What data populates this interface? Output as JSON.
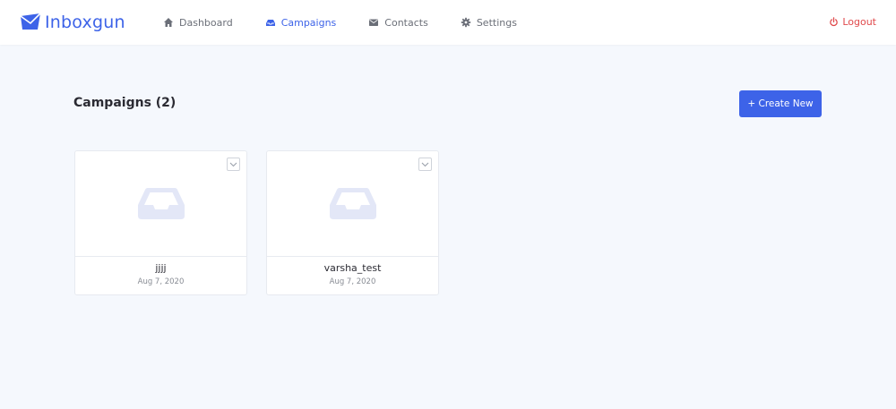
{
  "brand": {
    "name": "Inboxgun",
    "accent": "#3d63e8"
  },
  "nav": {
    "items": [
      {
        "label": "Dashboard",
        "icon": "home-icon"
      },
      {
        "label": "Campaigns",
        "icon": "inbox-icon",
        "active": true
      },
      {
        "label": "Contacts",
        "icon": "envelope-icon"
      },
      {
        "label": "Settings",
        "icon": "gear-icon"
      }
    ],
    "logout_label": "Logout"
  },
  "main": {
    "title": "Campaigns (2)",
    "create_label": "+ Create New",
    "campaigns": [
      {
        "name": "jjjj",
        "date": "Aug 7, 2020"
      },
      {
        "name": "varsha_test",
        "date": "Aug 7, 2020"
      }
    ]
  }
}
